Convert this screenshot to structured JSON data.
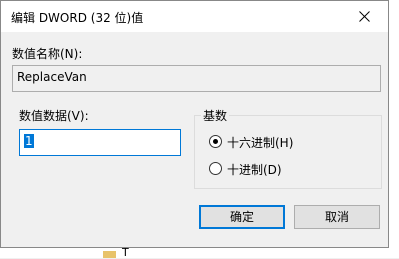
{
  "window": {
    "title": "编辑 DWORD (32 位)值"
  },
  "name_field": {
    "label": "数值名称(N):",
    "value": "ReplaceVan"
  },
  "data_field": {
    "label": "数值数据(V):",
    "value": "1"
  },
  "base_group": {
    "title": "基数",
    "options": [
      {
        "label": "十六进制(H)",
        "selected": true
      },
      {
        "label": "十进制(D)",
        "selected": false
      }
    ]
  },
  "buttons": {
    "ok_label": "确定",
    "cancel_label": "取消"
  },
  "background_item": {
    "text": "T"
  },
  "colors": {
    "accent": "#0078d7",
    "dialog_bg": "#f0f0f0",
    "button_bg": "#e1e1e1"
  },
  "icons": {
    "close": "close-icon",
    "folder": "folder-icon"
  }
}
